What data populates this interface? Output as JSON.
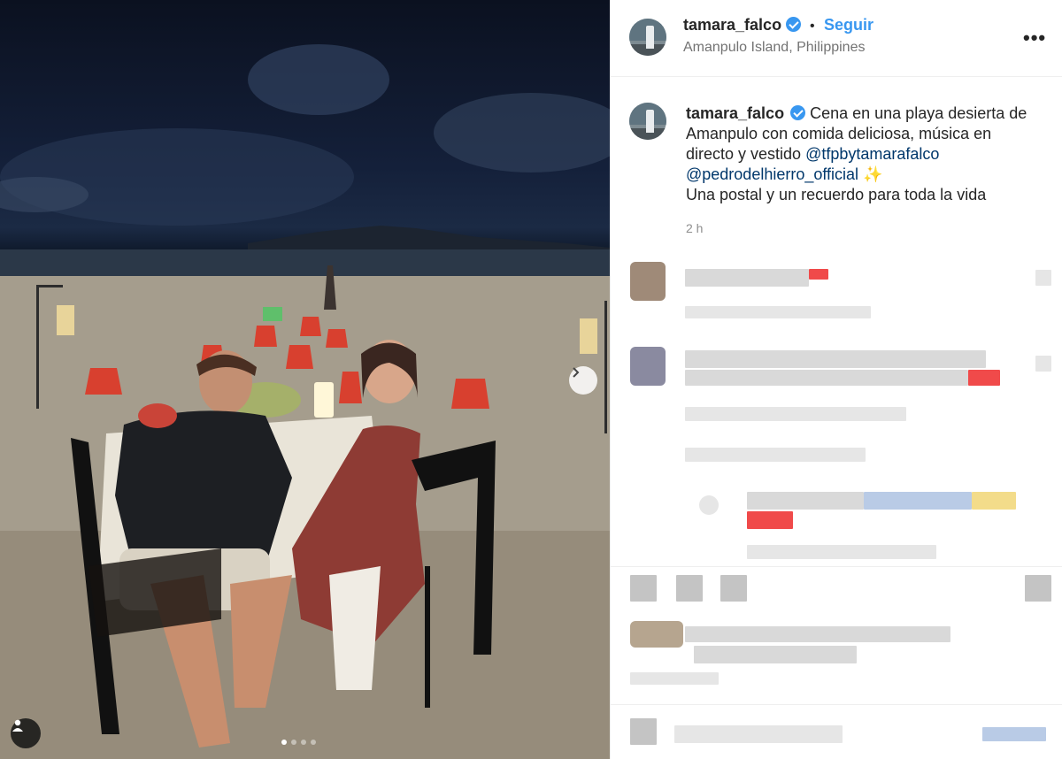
{
  "photo": {
    "next_label": "›",
    "slide_count": 4,
    "active_slide": 1,
    "tag_icon": "user-tag-icon"
  },
  "post": {
    "username": "tamara_falco",
    "verified": true,
    "separator": "•",
    "follow_label": "Seguir",
    "location": "Amanpulo Island, Philippines",
    "more_label": "•••",
    "caption_text_1": "Cena en una playa desierta de Amanpulo con comida deliciosa, música en directo y vestido",
    "mention_1": "@tfpbytamarafalco",
    "mention_2": "@pedrodelhierro_official",
    "sparkle": "✨",
    "caption_text_2": "Una postal y un recuerdo para toda la vida",
    "time": "2 h"
  },
  "colors": {
    "accent": "#3897f0",
    "mention": "#00376b",
    "muted": "#737373"
  }
}
